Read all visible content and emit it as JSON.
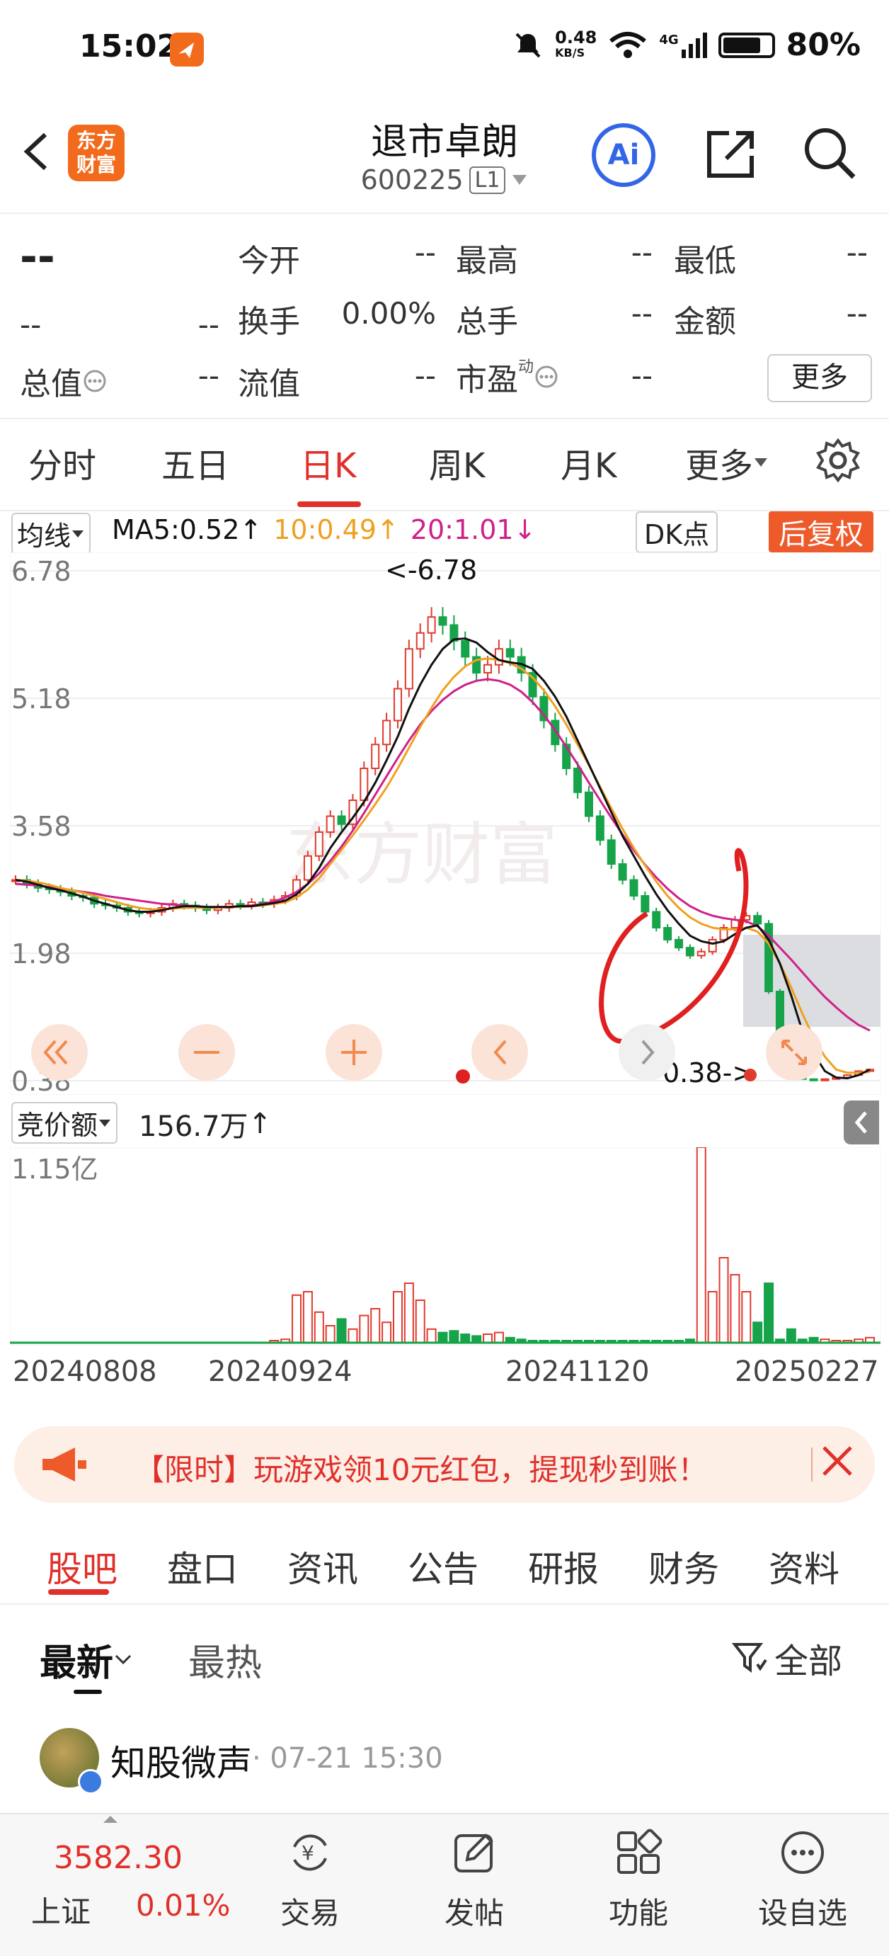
{
  "status_bar": {
    "time": "15:02",
    "net_speed": "0.48",
    "net_unit": "KB/S",
    "network": "4G",
    "battery": "80%"
  },
  "header": {
    "stock_name": "退市卓朗",
    "stock_code": "600225",
    "level_badge": "L1",
    "brand_lines": [
      "东方",
      "财富"
    ],
    "ai_label": "Ai"
  },
  "quote": {
    "price": "--",
    "change": "--",
    "change_pct": "--",
    "rows": [
      [
        {
          "label": "今开",
          "value": "--"
        },
        {
          "label": "最高",
          "value": "--"
        },
        {
          "label": "最低",
          "value": "--"
        }
      ],
      [
        {
          "label": "换手",
          "value": "0.00%"
        },
        {
          "label": "总手",
          "value": "--"
        },
        {
          "label": "金额",
          "value": "--"
        }
      ],
      [
        {
          "label": "流值",
          "value": "--"
        },
        {
          "label": "市盈",
          "value": "--"
        }
      ]
    ],
    "total_value_label": "总值",
    "total_value": "--",
    "pe_superscript": "动",
    "more_label": "更多"
  },
  "period_tabs": [
    "分时",
    "五日",
    "日K",
    "周K",
    "月K",
    "更多"
  ],
  "active_period": "日K",
  "ma_bar": {
    "selector": "均线",
    "ma5": "MA5:0.52",
    "ma10": "10:0.49",
    "ma20": "20:1.01",
    "dk_label": "DK点",
    "fuquan_label": "后复权"
  },
  "colors": {
    "up": "#e03a2e",
    "down": "#16a34a",
    "ma5": "#111111",
    "ma10": "#f0a020",
    "ma20": "#d0208a",
    "accent": "#e0302a"
  },
  "chart_data": {
    "type": "candlestick",
    "y_ticks": [
      "6.78",
      "5.18",
      "3.58",
      "1.98",
      "0.38"
    ],
    "ylim": [
      0.38,
      6.78
    ],
    "high_label": "<-6.78",
    "low_label": "0.38->",
    "watermark": "东方财富",
    "x_dates": [
      "20240808",
      "20240924",
      "20241120",
      "20250227"
    ],
    "closes": [
      2.9,
      2.85,
      2.8,
      2.78,
      2.75,
      2.7,
      2.68,
      2.6,
      2.58,
      2.55,
      2.5,
      2.48,
      2.5,
      2.55,
      2.6,
      2.58,
      2.55,
      2.52,
      2.55,
      2.6,
      2.58,
      2.62,
      2.6,
      2.65,
      2.7,
      2.9,
      3.2,
      3.5,
      3.7,
      3.6,
      3.9,
      4.3,
      4.6,
      4.9,
      5.3,
      5.8,
      6.0,
      6.2,
      6.1,
      5.9,
      5.7,
      5.5,
      5.6,
      5.8,
      5.7,
      5.5,
      5.2,
      4.9,
      4.6,
      4.3,
      4.0,
      3.7,
      3.4,
      3.1,
      2.9,
      2.7,
      2.5,
      2.3,
      2.15,
      2.05,
      1.95,
      2.0,
      2.15,
      2.3,
      2.4,
      2.45,
      2.35,
      1.5,
      0.8,
      0.45,
      0.4,
      0.39,
      0.4,
      0.42,
      0.45,
      0.5,
      0.52
    ],
    "ma5": [
      2.9,
      2.88,
      2.84,
      2.8,
      2.77,
      2.73,
      2.69,
      2.64,
      2.6,
      2.56,
      2.52,
      2.5,
      2.5,
      2.52,
      2.55,
      2.57,
      2.57,
      2.56,
      2.56,
      2.56,
      2.57,
      2.57,
      2.59,
      2.61,
      2.64,
      2.72,
      2.85,
      3.05,
      3.3,
      3.5,
      3.68,
      3.88,
      4.12,
      4.4,
      4.7,
      5.05,
      5.35,
      5.6,
      5.8,
      5.92,
      5.93,
      5.88,
      5.76,
      5.66,
      5.63,
      5.61,
      5.55,
      5.4,
      5.2,
      4.95,
      4.65,
      4.35,
      4.05,
      3.75,
      3.45,
      3.2,
      2.95,
      2.72,
      2.52,
      2.35,
      2.2,
      2.13,
      2.1,
      2.13,
      2.22,
      2.3,
      2.33,
      2.15,
      1.85,
      1.45,
      1.0,
      0.72,
      0.5,
      0.42,
      0.41,
      0.45,
      0.52
    ],
    "ma10": [
      2.9,
      2.89,
      2.87,
      2.84,
      2.8,
      2.77,
      2.74,
      2.7,
      2.66,
      2.62,
      2.58,
      2.55,
      2.53,
      2.53,
      2.54,
      2.55,
      2.55,
      2.55,
      2.55,
      2.56,
      2.56,
      2.57,
      2.58,
      2.6,
      2.62,
      2.68,
      2.78,
      2.92,
      3.1,
      3.28,
      3.46,
      3.65,
      3.85,
      4.06,
      4.3,
      4.56,
      4.82,
      5.06,
      5.28,
      5.45,
      5.58,
      5.66,
      5.68,
      5.66,
      5.62,
      5.55,
      5.44,
      5.28,
      5.08,
      4.85,
      4.6,
      4.34,
      4.07,
      3.8,
      3.54,
      3.3,
      3.08,
      2.88,
      2.7,
      2.55,
      2.43,
      2.35,
      2.3,
      2.28,
      2.28,
      2.3,
      2.25,
      2.1,
      1.85,
      1.55,
      1.22,
      0.92,
      0.68,
      0.52,
      0.48,
      0.48,
      0.49
    ],
    "ma20": [
      2.85,
      2.84,
      2.83,
      2.81,
      2.79,
      2.77,
      2.75,
      2.73,
      2.7,
      2.68,
      2.66,
      2.64,
      2.62,
      2.6,
      2.59,
      2.58,
      2.57,
      2.56,
      2.56,
      2.56,
      2.57,
      2.58,
      2.6,
      2.63,
      2.68,
      2.75,
      2.85,
      2.98,
      3.14,
      3.32,
      3.52,
      3.74,
      3.97,
      4.2,
      4.43,
      4.65,
      4.85,
      5.02,
      5.16,
      5.27,
      5.35,
      5.4,
      5.42,
      5.4,
      5.35,
      5.26,
      5.13,
      4.97,
      4.78,
      4.57,
      4.35,
      4.12,
      3.9,
      3.68,
      3.47,
      3.27,
      3.09,
      2.93,
      2.79,
      2.67,
      2.57,
      2.5,
      2.45,
      2.42,
      2.4,
      2.38,
      2.32,
      2.2,
      2.05,
      1.9,
      1.74,
      1.58,
      1.43,
      1.3,
      1.18,
      1.08,
      1.01
    ],
    "volumes_yi": [
      0,
      0,
      0,
      0,
      0,
      0,
      0,
      0,
      0,
      0,
      0,
      0,
      0,
      0,
      0,
      0,
      0,
      0,
      0,
      0,
      0,
      0,
      0,
      0.01,
      0.02,
      0.28,
      0.3,
      0.18,
      0.1,
      0.14,
      0.08,
      0.16,
      0.2,
      0.12,
      0.3,
      0.35,
      0.25,
      0.08,
      0.06,
      0.07,
      0.05,
      0.04,
      0.05,
      0.06,
      0.03,
      0.02,
      0.01,
      0.01,
      0.01,
      0.01,
      0.01,
      0.01,
      0.01,
      0.01,
      0.01,
      0.01,
      0.01,
      0.01,
      0.01,
      0.01,
      0.02,
      1.15,
      0.3,
      0.5,
      0.4,
      0.3,
      0.12,
      0.35,
      0.02,
      0.08,
      0.02,
      0.03,
      0.02,
      0.01,
      0.01,
      0.02,
      0.03
    ],
    "vol_max_label": "1.15亿",
    "vol_selector": "竞价额",
    "vol_value": "156.7万"
  },
  "promo": {
    "text": "【限时】玩游戏领10元红包，提现秒到账！"
  },
  "content_tabs": [
    "股吧",
    "盘口",
    "资讯",
    "公告",
    "研报",
    "财务",
    "资料"
  ],
  "active_content_tab": "股吧",
  "sort": {
    "latest": "最新",
    "hot": "最热",
    "filter": "全部"
  },
  "post": {
    "author": "知股微声",
    "time": "· 07-21 15:30"
  },
  "bottom_nav": {
    "index_value": "3582.30",
    "index_name": "上证",
    "index_change": "0.01%",
    "items": [
      {
        "label": "交易",
        "icon": "trade-icon"
      },
      {
        "label": "发帖",
        "icon": "compose-icon"
      },
      {
        "label": "功能",
        "icon": "apps-icon"
      },
      {
        "label": "设自选",
        "icon": "more-dots-icon"
      }
    ]
  }
}
